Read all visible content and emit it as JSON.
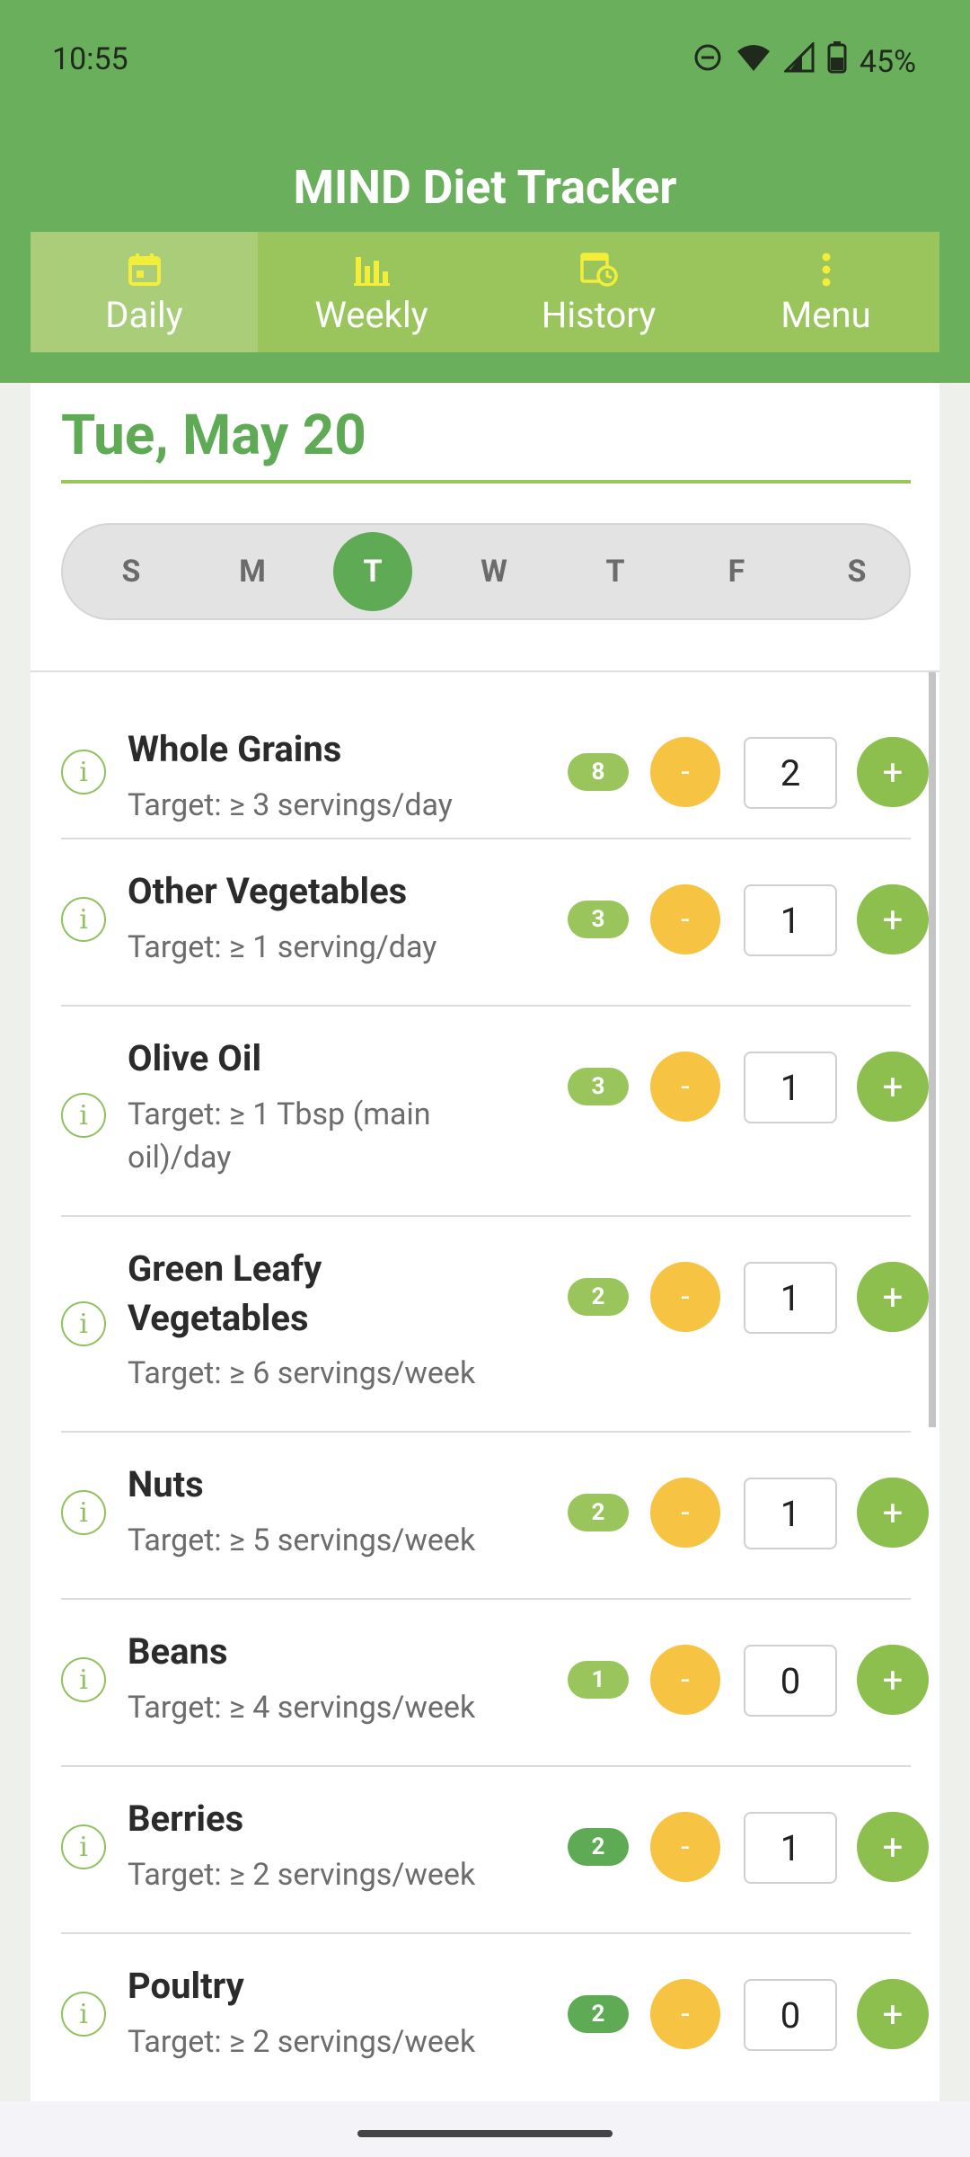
{
  "status_bar": {
    "time": "10:55",
    "battery": "45%",
    "icons": [
      "do-not-disturb-icon",
      "wifi-icon",
      "cell-signal-icon",
      "battery-icon"
    ]
  },
  "app": {
    "title": "MIND Diet Tracker"
  },
  "nav": {
    "tabs": [
      {
        "label": "Daily",
        "icon": "calendar-icon",
        "active": true
      },
      {
        "label": "Weekly",
        "icon": "bar-chart-icon",
        "active": false
      },
      {
        "label": "History",
        "icon": "history-icon",
        "active": false
      },
      {
        "label": "Menu",
        "icon": "more-vert-icon",
        "active": false
      }
    ]
  },
  "date": {
    "title": "Tue, May 20"
  },
  "week": {
    "days": [
      "S",
      "M",
      "T",
      "W",
      "T",
      "F",
      "S"
    ],
    "selected_index": 2
  },
  "foods": [
    {
      "name": "Whole Grains",
      "target": "Target: ≥ 3 servings/day",
      "badge": "8",
      "qty": "2"
    },
    {
      "name": "Other Vegetables",
      "target": "Target: ≥ 1 serving/day",
      "badge": "3",
      "qty": "1"
    },
    {
      "name": "Olive Oil",
      "target": "Target: ≥ 1 Tbsp (main oil)/day",
      "badge": "3",
      "qty": "1"
    },
    {
      "name": "Green Leafy Vegetables",
      "target": "Target: ≥ 6 servings/week",
      "badge": "2",
      "qty": "1"
    },
    {
      "name": "Nuts",
      "target": "Target: ≥ 5 servings/week",
      "badge": "2",
      "qty": "1"
    },
    {
      "name": "Beans",
      "target": "Target: ≥ 4 servings/week",
      "badge": "1",
      "qty": "0"
    },
    {
      "name": "Berries",
      "target": "Target: ≥ 2 servings/week",
      "badge": "2",
      "qty": "1"
    },
    {
      "name": "Poultry",
      "target": "Target: ≥ 2 servings/week",
      "badge": "2",
      "qty": "0"
    }
  ],
  "controls": {
    "minus_label": "-",
    "plus_label": "+",
    "info_label": "i"
  },
  "colors": {
    "primary": "#6aaf5c",
    "accent_green": "#5eaa55",
    "light_green": "#9ac55c",
    "minus_yellow": "#f6c342"
  }
}
